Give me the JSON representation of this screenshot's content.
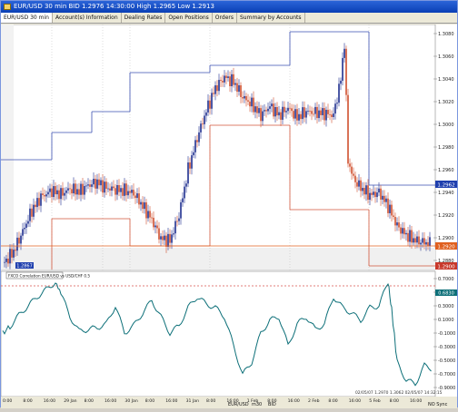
{
  "window": {
    "title": "EUR/USD 30 min BID 1.2976 14:30:00 High 1.2965 Low 1.2913"
  },
  "tabs": [
    {
      "label": "EUR/USD 30 min"
    },
    {
      "label": "Account(s) Information"
    },
    {
      "label": "Dealing Rates"
    },
    {
      "label": "Open Positions"
    },
    {
      "label": "Orders"
    },
    {
      "label": "Summary by Accounts"
    }
  ],
  "price_axis": {
    "ticks": [
      "1.3080",
      "1.3060",
      "1.3040",
      "1.3020",
      "1.3000",
      "1.2980",
      "1.2960",
      "1.2940",
      "1.2920",
      "1.2900",
      "1.2880"
    ],
    "upper_level_label": "1.2962",
    "current_label": "1.2920",
    "lower_level_label": "1.2900",
    "start_marker": "1.2867"
  },
  "indicator": {
    "label": "FXCO Correlation EUR/USD vs USD/CHF 0.5",
    "ticks": [
      "0.7000",
      "0.5000",
      "0.3000",
      "0.1000",
      "-0.1000",
      "-0.3000",
      "-0.5000",
      "-0.7000",
      "-0.9000"
    ],
    "current_label": "0.6830"
  },
  "time_axis": {
    "labels": [
      "0:00",
      "8:00",
      "16:00",
      "29 Jan",
      "8:00",
      "16:00",
      "30 Jan",
      "8:00",
      "16:00",
      "31 Jan",
      "8:00",
      "16:00",
      "1 Feb",
      "8:00",
      "16:00",
      "2 Feb",
      "8:00",
      "16:00",
      "5 Feb",
      "8:00",
      "16:00"
    ]
  },
  "status_bar": {
    "symbol": "EUR/USD",
    "timeframe": "m30",
    "mode": "BID",
    "button": "NO Sync",
    "time_info": "02/05/07 1.2970 1.3062 02/05/07 14:32:15"
  }
}
